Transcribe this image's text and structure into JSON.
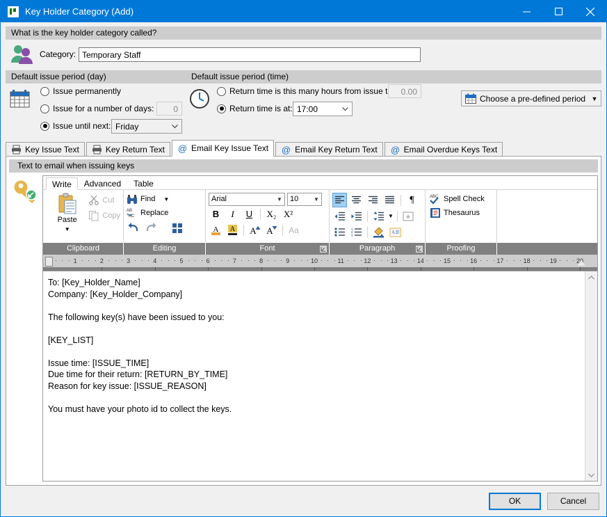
{
  "window": {
    "title": "Key Holder Category (Add)",
    "app_icon": "key-app-icon",
    "minimize": "minimize-icon",
    "maximize": "maximize-icon",
    "close": "close-icon"
  },
  "category_section": {
    "header": "What is the key holder category called?",
    "icon": "people-icon",
    "label": "Category:",
    "value": "Temporary Staff"
  },
  "issue_day": {
    "header": "Default issue period (day)",
    "icon": "calendar-icon",
    "opt_permanent": "Issue permanently",
    "opt_days": "Issue for a number of days:",
    "days_value": "0",
    "opt_until": "Issue until next:",
    "until_value": "Friday",
    "selected": "until"
  },
  "issue_time": {
    "header": "Default issue period (time)",
    "icon": "clock-icon",
    "opt_hours": "Return time is this many hours from issue time:",
    "hours_value": "0.00",
    "opt_at": "Return time is at:",
    "at_value": "17:00",
    "selected": "at",
    "predefined_label": "Choose a pre-defined period",
    "predefined_icon": "calendar-icon"
  },
  "tabs": [
    {
      "label": "Key Issue Text",
      "icon": "printer-icon",
      "active": false
    },
    {
      "label": "Key Return Text",
      "icon": "printer-icon",
      "active": false
    },
    {
      "label": "Email Key Issue Text",
      "icon": "at-icon",
      "active": true
    },
    {
      "label": "Email Key Return Text",
      "icon": "at-icon",
      "active": false
    },
    {
      "label": "Email Overdue Keys Text",
      "icon": "at-icon",
      "active": false
    }
  ],
  "editor": {
    "panel_header": "Text to email when issuing keys",
    "key_icon": "key-icon",
    "ribbon_tabs": [
      {
        "label": "Write",
        "active": true
      },
      {
        "label": "Advanced",
        "active": false
      },
      {
        "label": "Table",
        "active": false
      }
    ],
    "groups": {
      "clipboard": {
        "footer": "Clipboard",
        "paste": "Paste",
        "paste_icon": "paste-icon",
        "cut": "Cut",
        "cut_icon": "scissors-icon",
        "copy": "Copy",
        "copy_icon": "copy-icon"
      },
      "editing": {
        "footer": "Editing",
        "find": "Find",
        "find_icon": "binoculars-icon",
        "replace": "Replace",
        "replace_icon": "replace-abac-icon",
        "undo_icon": "undo-arrow-icon",
        "redo_icon": "redo-arrow-icon",
        "grid_icon": "select-grid-icon"
      },
      "font": {
        "footer": "Font",
        "font_name": "Arial",
        "font_size": "10",
        "bold": "B",
        "italic": "I",
        "underline": "U",
        "subscript": "X₂",
        "superscript": "X²",
        "font_color_icon": "font-color-a-icon",
        "highlight_icon": "text-highlight-icon",
        "grow_icon": "grow-font-icon",
        "shrink_icon": "shrink-font-icon",
        "change_case": "Aa",
        "dialog_launcher": "dialog-launcher-icon"
      },
      "paragraph": {
        "footer": "Paragraph",
        "align_left_icon": "align-left-icon",
        "align_center_icon": "align-center-icon",
        "align_right_icon": "align-right-icon",
        "align_justify_icon": "align-justify-icon",
        "pilcrow_icon": "pilcrow-icon",
        "indent_decrease_icon": "decrease-indent-icon",
        "indent_increase_icon": "increase-indent-icon",
        "line_spacing_icon": "line-spacing-icon",
        "borders_icon": "borders-icon",
        "bullets_icon": "bullet-list-icon",
        "numbering_icon": "numbered-list-icon",
        "shading_icon": "shading-paint-icon",
        "textbox_icon": "text-box-icon",
        "dialog_launcher": "dialog-launcher-icon",
        "active_align": "left"
      },
      "proofing": {
        "footer": "Proofing",
        "spell_check": "Spell Check",
        "spell_icon": "abc-check-icon",
        "thesaurus": "Thesaurus",
        "thesaurus_icon": "thesaurus-book-icon"
      }
    },
    "ruler": {
      "numbers": [
        "1",
        "2",
        "3",
        "4",
        "5",
        "6",
        "7",
        "8",
        "9",
        "10",
        "11",
        "12",
        "13",
        "14",
        "15",
        "16",
        "17",
        "18",
        "19",
        "20"
      ],
      "left_indent_marker": "left-indent-marker",
      "right_indent_marker": "right-indent-marker"
    },
    "document_text": "To: [Key_Holder_Name]\nCompany: [Key_Holder_Company]\n\nThe following key(s) have been issued to you:\n\n[KEY_LIST]\n\nIssue time: [ISSUE_TIME]\nDue time for their return: [RETURN_BY_TIME]\nReason for key issue: [ISSUE_REASON]\n\nYou must have your photo id to collect the keys.",
    "scroll_up_icon": "scroll-up-arrow-icon",
    "scroll_down_icon": "scroll-down-arrow-icon"
  },
  "footer": {
    "ok": "OK",
    "cancel": "Cancel"
  },
  "colors": {
    "accent": "#0078d7",
    "group_header": "#cdcdcd",
    "ribbon_footer": "#808080",
    "window_bg": "#f0f0f0"
  }
}
